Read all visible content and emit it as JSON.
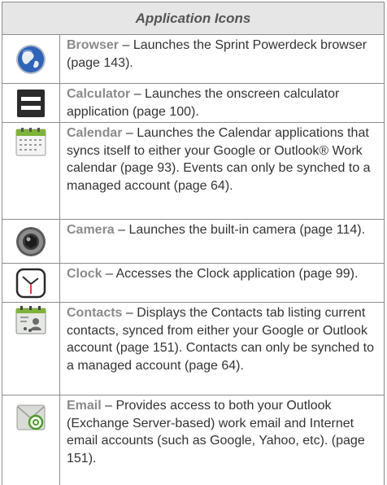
{
  "table": {
    "title": "Application Icons",
    "rows": [
      {
        "icon": "browser-globe-icon",
        "name": "Browser",
        "desc": " – Launches the Sprint Powerdeck browser (page 143)."
      },
      {
        "icon": "calculator-icon",
        "name": "Calculator",
        "desc": " – Launches the onscreen calculator application (page 100)."
      },
      {
        "icon": "calendar-icon",
        "name": "Calendar",
        "desc": " – Launches the Calendar applications that syncs itself to either your Google or Outlook® Work calendar (page 93). Events can only be synched to a managed account (page 64)."
      },
      {
        "icon": "camera-icon",
        "name": "Camera",
        "desc": " – Launches the built-in camera (page 114)."
      },
      {
        "icon": "clock-icon",
        "name": "Clock",
        "desc": " – Accesses the Clock application (page 99)."
      },
      {
        "icon": "contacts-icon",
        "name": "Contacts",
        "desc": " – Displays the Contacts tab listing current contacts, synced from either your Google or Outlook account (page 151). Contacts can only be synched to a managed account (page 64)."
      },
      {
        "icon": "email-icon",
        "name": "Email",
        "desc": " – Provides access to both your Outlook (Exchange Server-based) work email and Internet email accounts (such as Google, Yahoo, etc). (page 151)."
      }
    ]
  }
}
